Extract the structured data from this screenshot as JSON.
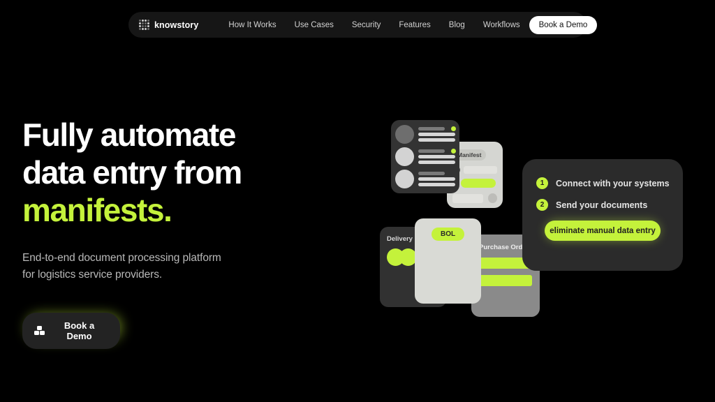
{
  "nav": {
    "brand": {
      "name": "knowstory",
      "icon": "grid-dots-logo-icon"
    },
    "links": [
      {
        "label": "How It Works"
      },
      {
        "label": "Use Cases"
      },
      {
        "label": "Security"
      },
      {
        "label": "Features"
      },
      {
        "label": "Blog"
      },
      {
        "label": "Workflows"
      }
    ],
    "cta": {
      "label": "Book a Demo"
    }
  },
  "hero": {
    "headline_line1": "Fully automate",
    "headline_line2": "data entry from",
    "headline_accent": "manifests.",
    "sub_line1": "End-to-end document processing platform",
    "sub_line2": "for logistics service providers.",
    "cta": {
      "label": "Book a Demo",
      "icon": "boxes-icon"
    }
  },
  "illustration": {
    "steps_panel": {
      "steps": [
        {
          "num": "1",
          "label": "Connect with your systems"
        },
        {
          "num": "2",
          "label": "Send your documents"
        }
      ],
      "cta_label": "eliminate manual data entry"
    },
    "cards": {
      "manifest_label": "Manifest",
      "delivery_label": "Delivery",
      "bol_label": "BOL",
      "purchase_order_label": "Purchase Order"
    }
  },
  "colors": {
    "background": "#000000",
    "accent_green": "#c4f23b",
    "nav_bg": "#161616",
    "panel_dark": "#2b2b2b",
    "card_light": "#d5d6d2",
    "card_gray": "#8a8a8a",
    "text_primary": "#ffffff",
    "text_secondary": "#b9b9b9"
  }
}
